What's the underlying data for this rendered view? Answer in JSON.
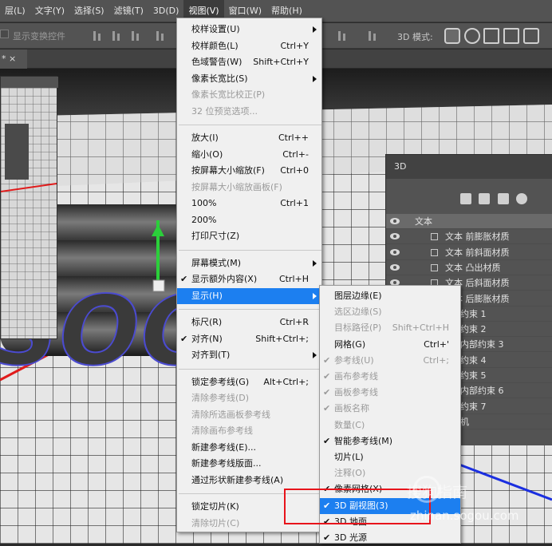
{
  "menubar": {
    "items": [
      "层(L)",
      "文字(Y)",
      "选择(S)",
      "滤镜(T)",
      "3D(D)",
      "视图(V)",
      "窗口(W)",
      "帮助(H)"
    ],
    "active": "视图(V)"
  },
  "options_bar": {
    "show_transform_controls": "显示变换控件",
    "mode_label": "3D 模式:",
    "mode_icons": [
      "rotate-3d-icon",
      "roll-3d-icon",
      "pan-3d-icon",
      "slide-3d-icon",
      "scale-3d-icon"
    ]
  },
  "document_tab": {
    "label": "* ×"
  },
  "panel3d": {
    "title": "3D",
    "tool_icons": [
      "scene-filter-icon",
      "mesh-filter-icon",
      "material-filter-icon",
      "light-filter-icon"
    ],
    "layers": [
      {
        "label": "文本",
        "kind": "root"
      },
      {
        "label": "文本 前膨胀材质",
        "kind": "material"
      },
      {
        "label": "文本 前斜面材质",
        "kind": "material"
      },
      {
        "label": "文本 凸出材质",
        "kind": "material"
      },
      {
        "label": "文本 后斜面材质",
        "kind": "material"
      },
      {
        "label": "文本 后膨胀材质",
        "kind": "material"
      },
      {
        "label": "约束 1",
        "kind": "constraint"
      },
      {
        "label": "约束 2",
        "kind": "constraint"
      },
      {
        "label": "内部约束 3",
        "kind": "constraint"
      },
      {
        "label": "约束 4",
        "kind": "constraint"
      },
      {
        "label": "约束 5",
        "kind": "constraint"
      },
      {
        "label": "内部约束 6",
        "kind": "constraint"
      },
      {
        "label": "约束 7",
        "kind": "constraint"
      },
      {
        "label": "机",
        "kind": "camera"
      }
    ]
  },
  "view_menu": {
    "items": [
      {
        "label": "校样设置(U)",
        "shortcut": "",
        "submenu": true,
        "disabled": false,
        "checked": false
      },
      {
        "label": "校样颜色(L)",
        "shortcut": "Ctrl+Y",
        "submenu": false,
        "disabled": false,
        "checked": false
      },
      {
        "label": "色域警告(W)",
        "shortcut": "Shift+Ctrl+Y",
        "submenu": false,
        "disabled": false,
        "checked": false
      },
      {
        "label": "像素长宽比(S)",
        "shortcut": "",
        "submenu": true,
        "disabled": false,
        "checked": false
      },
      {
        "label": "像素长宽比校正(P)",
        "shortcut": "",
        "submenu": false,
        "disabled": true,
        "checked": false
      },
      {
        "label": "32 位预览选项...",
        "shortcut": "",
        "submenu": false,
        "disabled": true,
        "checked": false
      },
      {
        "label": "放大(I)",
        "shortcut": "Ctrl++",
        "submenu": false,
        "disabled": false,
        "checked": false
      },
      {
        "label": "缩小(O)",
        "shortcut": "Ctrl+-",
        "submenu": false,
        "disabled": false,
        "checked": false
      },
      {
        "label": "按屏幕大小缩放(F)",
        "shortcut": "Ctrl+0",
        "submenu": false,
        "disabled": false,
        "checked": false
      },
      {
        "label": "按屏幕大小缩放画板(F)",
        "shortcut": "",
        "submenu": false,
        "disabled": true,
        "checked": false
      },
      {
        "label": "100%",
        "shortcut": "Ctrl+1",
        "submenu": false,
        "disabled": false,
        "checked": false
      },
      {
        "label": "200%",
        "shortcut": "",
        "submenu": false,
        "disabled": false,
        "checked": false
      },
      {
        "label": "打印尺寸(Z)",
        "shortcut": "",
        "submenu": false,
        "disabled": false,
        "checked": false
      },
      {
        "label": "屏幕模式(M)",
        "shortcut": "",
        "submenu": true,
        "disabled": false,
        "checked": false
      },
      {
        "label": "显示额外内容(X)",
        "shortcut": "Ctrl+H",
        "submenu": false,
        "disabled": false,
        "checked": true
      },
      {
        "label": "显示(H)",
        "shortcut": "",
        "submenu": true,
        "disabled": false,
        "checked": false,
        "highlight": true
      },
      {
        "label": "标尺(R)",
        "shortcut": "Ctrl+R",
        "submenu": false,
        "disabled": false,
        "checked": false
      },
      {
        "label": "对齐(N)",
        "shortcut": "Shift+Ctrl+;",
        "submenu": false,
        "disabled": false,
        "checked": true
      },
      {
        "label": "对齐到(T)",
        "shortcut": "",
        "submenu": true,
        "disabled": false,
        "checked": false
      },
      {
        "label": "锁定参考线(G)",
        "shortcut": "Alt+Ctrl+;",
        "submenu": false,
        "disabled": false,
        "checked": false
      },
      {
        "label": "清除参考线(D)",
        "shortcut": "",
        "submenu": false,
        "disabled": true,
        "checked": false
      },
      {
        "label": "清除所选画板参考线",
        "shortcut": "",
        "submenu": false,
        "disabled": true,
        "checked": false
      },
      {
        "label": "清除画布参考线",
        "shortcut": "",
        "submenu": false,
        "disabled": true,
        "checked": false
      },
      {
        "label": "新建参考线(E)...",
        "shortcut": "",
        "submenu": false,
        "disabled": false,
        "checked": false
      },
      {
        "label": "新建参考线版面...",
        "shortcut": "",
        "submenu": false,
        "disabled": false,
        "checked": false
      },
      {
        "label": "通过形状新建参考线(A)",
        "shortcut": "",
        "submenu": false,
        "disabled": false,
        "checked": false
      },
      {
        "label": "锁定切片(K)",
        "shortcut": "",
        "submenu": false,
        "disabled": false,
        "checked": false
      },
      {
        "label": "清除切片(C)",
        "shortcut": "",
        "submenu": false,
        "disabled": true,
        "checked": false
      }
    ]
  },
  "show_submenu": {
    "items": [
      {
        "label": "图层边缘(E)",
        "shortcut": "",
        "disabled": false,
        "checked": false
      },
      {
        "label": "选区边缘(S)",
        "shortcut": "",
        "disabled": true,
        "checked": false
      },
      {
        "label": "目标路径(P)",
        "shortcut": "Shift+Ctrl+H",
        "disabled": true,
        "checked": false
      },
      {
        "label": "网格(G)",
        "shortcut": "Ctrl+'",
        "disabled": false,
        "checked": false
      },
      {
        "label": "参考线(U)",
        "shortcut": "Ctrl+;",
        "disabled": true,
        "checked": true
      },
      {
        "label": "画布参考线",
        "shortcut": "",
        "disabled": true,
        "checked": true
      },
      {
        "label": "画板参考线",
        "shortcut": "",
        "disabled": true,
        "checked": true
      },
      {
        "label": "画板名称",
        "shortcut": "",
        "disabled": true,
        "checked": true
      },
      {
        "label": "数量(C)",
        "shortcut": "",
        "disabled": true,
        "checked": false
      },
      {
        "label": "智能参考线(M)",
        "shortcut": "",
        "disabled": false,
        "checked": true
      },
      {
        "label": "切片(L)",
        "shortcut": "",
        "disabled": false,
        "checked": false
      },
      {
        "label": "注释(O)",
        "shortcut": "",
        "disabled": true,
        "checked": false
      },
      {
        "label": "像素网格(X)",
        "shortcut": "",
        "disabled": false,
        "checked": true
      },
      {
        "label": "3D 副视图(3)",
        "shortcut": "",
        "disabled": false,
        "checked": true,
        "highlight": true
      },
      {
        "label": "3D 地面",
        "shortcut": "",
        "disabled": false,
        "checked": true
      },
      {
        "label": "3D 光源",
        "shortcut": "",
        "disabled": false,
        "checked": true
      }
    ]
  },
  "canvas": {
    "text": "SOC"
  },
  "watermark": {
    "line1": "搜狗指南",
    "line2": "zhinan.sogou.com"
  }
}
